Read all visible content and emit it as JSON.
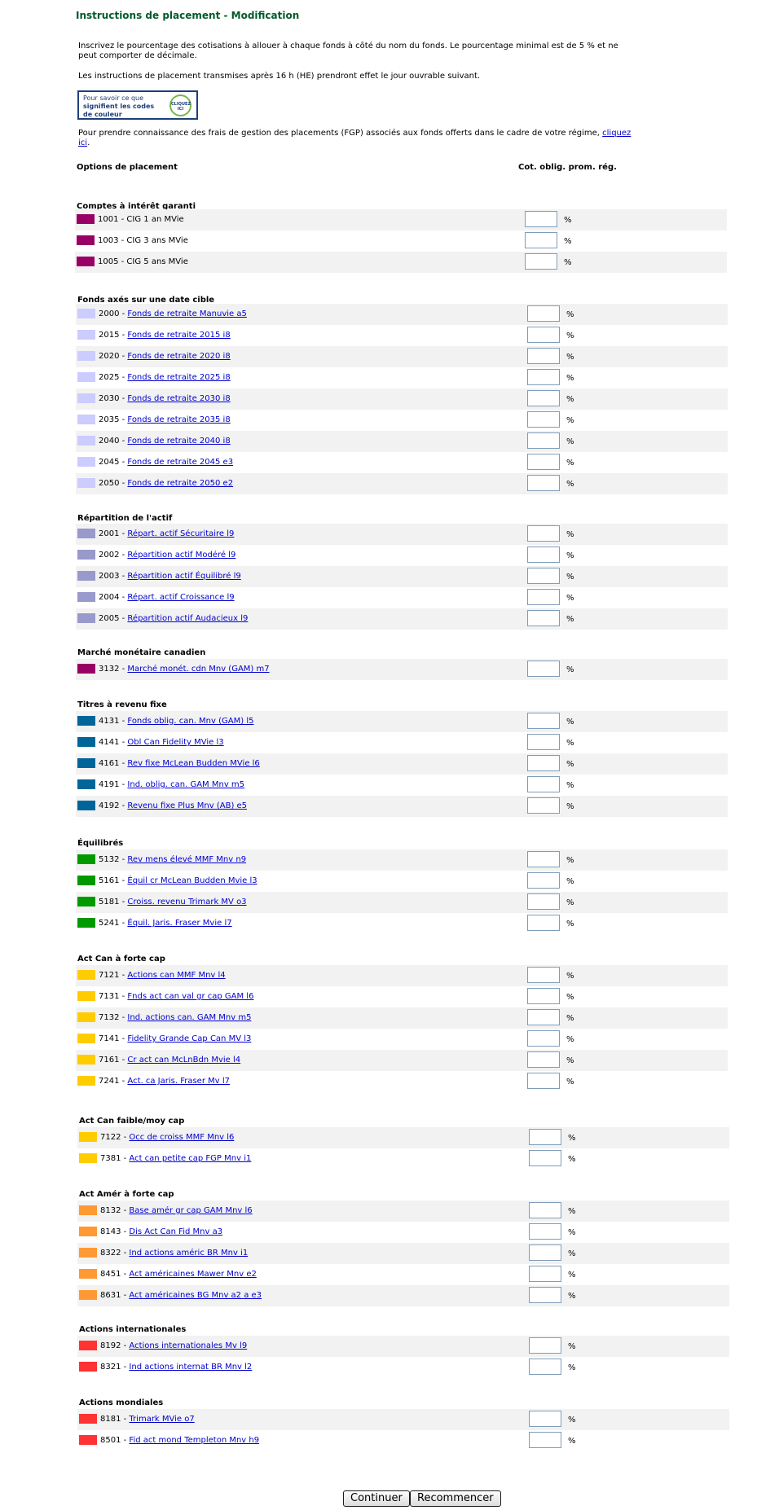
{
  "page": {
    "title": "Instructions de placement - Modification",
    "intro1": "Inscrivez le pourcentage des cotisations à allouer à chaque fonds à côté du nom du fonds. Le pourcentage minimal est de 5 % et ne peut comporter de décimale.",
    "intro2": "Les instructions de placement transmises après 16 h (HE) prendront effet le jour ouvrable suivant.",
    "legend": {
      "line1": "Pour savoir ce que",
      "line2": "signifient les codes",
      "line3": "de couleur",
      "badge": "CLIQUEZ ICI"
    },
    "fgp_text": "Pour prendre connaissance des frais de gestion des placements (FGP) associés aux fonds offerts dans le cadre de votre régime,",
    "fgp_link": "cliquez ici",
    "fgp_end": "."
  },
  "columns": {
    "options": "Options de placement",
    "contrib": "Cot. oblig. prom. rég."
  },
  "sections": [
    {
      "title": "Comptes à intérêt garanti",
      "color": "#990066",
      "funds": [
        {
          "code": "1001",
          "name": "CIG 1 an MVie",
          "link": false
        },
        {
          "code": "1003",
          "name": "CIG 3 ans MVie",
          "link": false
        },
        {
          "code": "1005",
          "name": "CIG 5 ans MVie",
          "link": false
        }
      ]
    },
    {
      "title": "Fonds axés sur une date cible",
      "color": "#ccccff",
      "funds": [
        {
          "code": "2000",
          "name": "Fonds de retraite Manuvie a5",
          "link": true
        },
        {
          "code": "2015",
          "name": "Fonds de retraite 2015 i8",
          "link": true
        },
        {
          "code": "2020",
          "name": "Fonds de retraite 2020 i8",
          "link": true
        },
        {
          "code": "2025",
          "name": "Fonds de retraite 2025 i8",
          "link": true
        },
        {
          "code": "2030",
          "name": "Fonds de retraite 2030 i8",
          "link": true
        },
        {
          "code": "2035",
          "name": "Fonds de retraite 2035 i8",
          "link": true
        },
        {
          "code": "2040",
          "name": "Fonds de retraite 2040 i8",
          "link": true
        },
        {
          "code": "2045",
          "name": "Fonds de retraite 2045 e3",
          "link": true
        },
        {
          "code": "2050",
          "name": "Fonds de retraite 2050 e2",
          "link": true
        }
      ]
    },
    {
      "title": "Répartition de l'actif",
      "color": "#9999cc",
      "funds": [
        {
          "code": "2001",
          "name": "Répart. actif Sécuritaire l9",
          "link": true
        },
        {
          "code": "2002",
          "name": "Répartition actif Modéré l9",
          "link": true
        },
        {
          "code": "2003",
          "name": "Répartition actif Équilibré l9",
          "link": true
        },
        {
          "code": "2004",
          "name": "Répart. actif Croissance l9",
          "link": true
        },
        {
          "code": "2005",
          "name": "Répartition actif Audacieux l9",
          "link": true
        }
      ]
    },
    {
      "title": "Marché monétaire canadien",
      "color": "#990066",
      "funds": [
        {
          "code": "3132",
          "name": "Marché monét. cdn Mnv (GAM) m7",
          "link": true
        }
      ]
    },
    {
      "title": "Titres à revenu fixe",
      "color": "#006699",
      "funds": [
        {
          "code": "4131",
          "name": "Fonds oblig. can. Mnv (GAM) l5",
          "link": true
        },
        {
          "code": "4141",
          "name": "Obl Can Fidelity MVie l3",
          "link": true
        },
        {
          "code": "4161",
          "name": "Rev fixe McLean Budden MVie l6",
          "link": true
        },
        {
          "code": "4191",
          "name": "Ind. oblig. can. GAM Mnv m5",
          "link": true
        },
        {
          "code": "4192",
          "name": "Revenu fixe Plus Mnv (AB) e5",
          "link": true
        }
      ]
    },
    {
      "title": "Équilibrés",
      "color": "#009900",
      "funds": [
        {
          "code": "5132",
          "name": "Rev mens élevé MMF Mnv n9",
          "link": true
        },
        {
          "code": "5161",
          "name": "Équil cr McLean Budden Mvie l3",
          "link": true
        },
        {
          "code": "5181",
          "name": "Croiss. revenu Trimark MV o3",
          "link": true
        },
        {
          "code": "5241",
          "name": "Équil. Jaris. Fraser Mvie l7",
          "link": true
        }
      ]
    },
    {
      "title": "Act Can à forte cap",
      "color": "#ffcc00",
      "funds": [
        {
          "code": "7121",
          "name": "Actions can MMF Mnv l4",
          "link": true
        },
        {
          "code": "7131",
          "name": "Fnds act can val gr cap GAM l6",
          "link": true
        },
        {
          "code": "7132",
          "name": "Ind. actions can. GAM Mnv m5",
          "link": true
        },
        {
          "code": "7141",
          "name": "Fidelity Grande Cap Can MV l3",
          "link": true
        },
        {
          "code": "7161",
          "name": "Cr act can McLnBdn Mvie l4",
          "link": true
        },
        {
          "code": "7241",
          "name": "Act. ca Jaris. Fraser Mv l7",
          "link": true
        }
      ]
    },
    {
      "title": "Act Can faible/moy cap",
      "color": "#ffcc00",
      "funds": [
        {
          "code": "7122",
          "name": "Occ de croiss MMF Mnv l6",
          "link": true
        },
        {
          "code": "7381",
          "name": "Act can petite cap FGP Mnv i1",
          "link": true
        }
      ]
    },
    {
      "title": "Act Amér à forte cap",
      "color": "#ff9933",
      "funds": [
        {
          "code": "8132",
          "name": "Base amér gr cap GAM Mnv l6",
          "link": true
        },
        {
          "code": "8143",
          "name": "Dis Act Can Fid Mnv a3",
          "link": true
        },
        {
          "code": "8322",
          "name": "Ind actions améric BR Mnv i1",
          "link": true
        },
        {
          "code": "8451",
          "name": "Act américaines Mawer Mnv e2",
          "link": true
        },
        {
          "code": "8631",
          "name": "Act américaines BG Mnv a2 a e3",
          "link": true
        }
      ]
    },
    {
      "title": "Actions internationales",
      "color": "#ff3333",
      "funds": [
        {
          "code": "8192",
          "name": "Actions internationales Mv l9",
          "link": true
        },
        {
          "code": "8321",
          "name": "Ind actions internat BR Mnv l2",
          "link": true
        }
      ]
    },
    {
      "title": "Actions mondiales",
      "color": "#ff3333",
      "funds": [
        {
          "code": "8181",
          "name": "Trimark MVie o7",
          "link": true
        },
        {
          "code": "8501",
          "name": "Fid act mond Templeton Mnv h9",
          "link": true
        }
      ]
    }
  ],
  "percent_sign": "%",
  "buttons": {
    "continue": "Continuer",
    "reset": "Recommencer"
  }
}
